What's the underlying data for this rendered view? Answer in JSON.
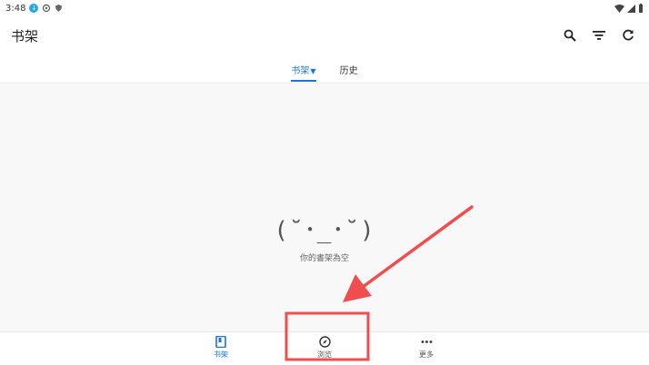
{
  "status": {
    "time": "3:48"
  },
  "app": {
    "title": "书架"
  },
  "tabs": [
    {
      "label": "书架",
      "arrow": "▼"
    },
    {
      "label": "历史"
    }
  ],
  "empty": {
    "kaomoji": "(˘･_･˘)",
    "message": "你的書架為空"
  },
  "nav": [
    {
      "label": "书架",
      "icon": "book-icon"
    },
    {
      "label": "浏览",
      "icon": "compass-icon"
    },
    {
      "label": "更多",
      "icon": "more-horiz-icon"
    }
  ],
  "colors": {
    "accent": "#1976d2",
    "annotation": "#f04e4e"
  }
}
